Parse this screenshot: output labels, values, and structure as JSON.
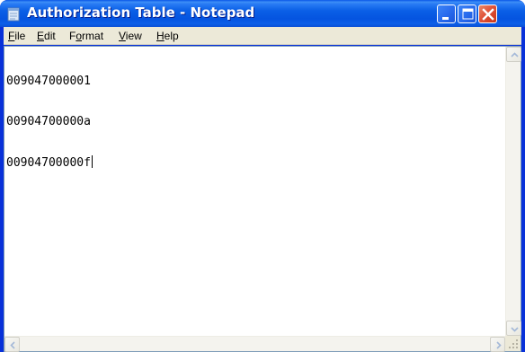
{
  "window": {
    "title": "Authorization Table - Notepad",
    "app_icon": "notepad-icon"
  },
  "menu": {
    "items": [
      {
        "label": "File",
        "accesskey": "F"
      },
      {
        "label": "Edit",
        "accesskey": "E"
      },
      {
        "label": "Format",
        "accesskey": "o"
      },
      {
        "label": "View",
        "accesskey": "V"
      },
      {
        "label": "Help",
        "accesskey": "H"
      }
    ]
  },
  "document": {
    "lines": [
      "009047000001",
      "00904700000a",
      "00904700000f"
    ]
  },
  "colors": {
    "titlebar": "#0a58e8",
    "close_button": "#e0533a",
    "menubar": "#ece9d8"
  }
}
